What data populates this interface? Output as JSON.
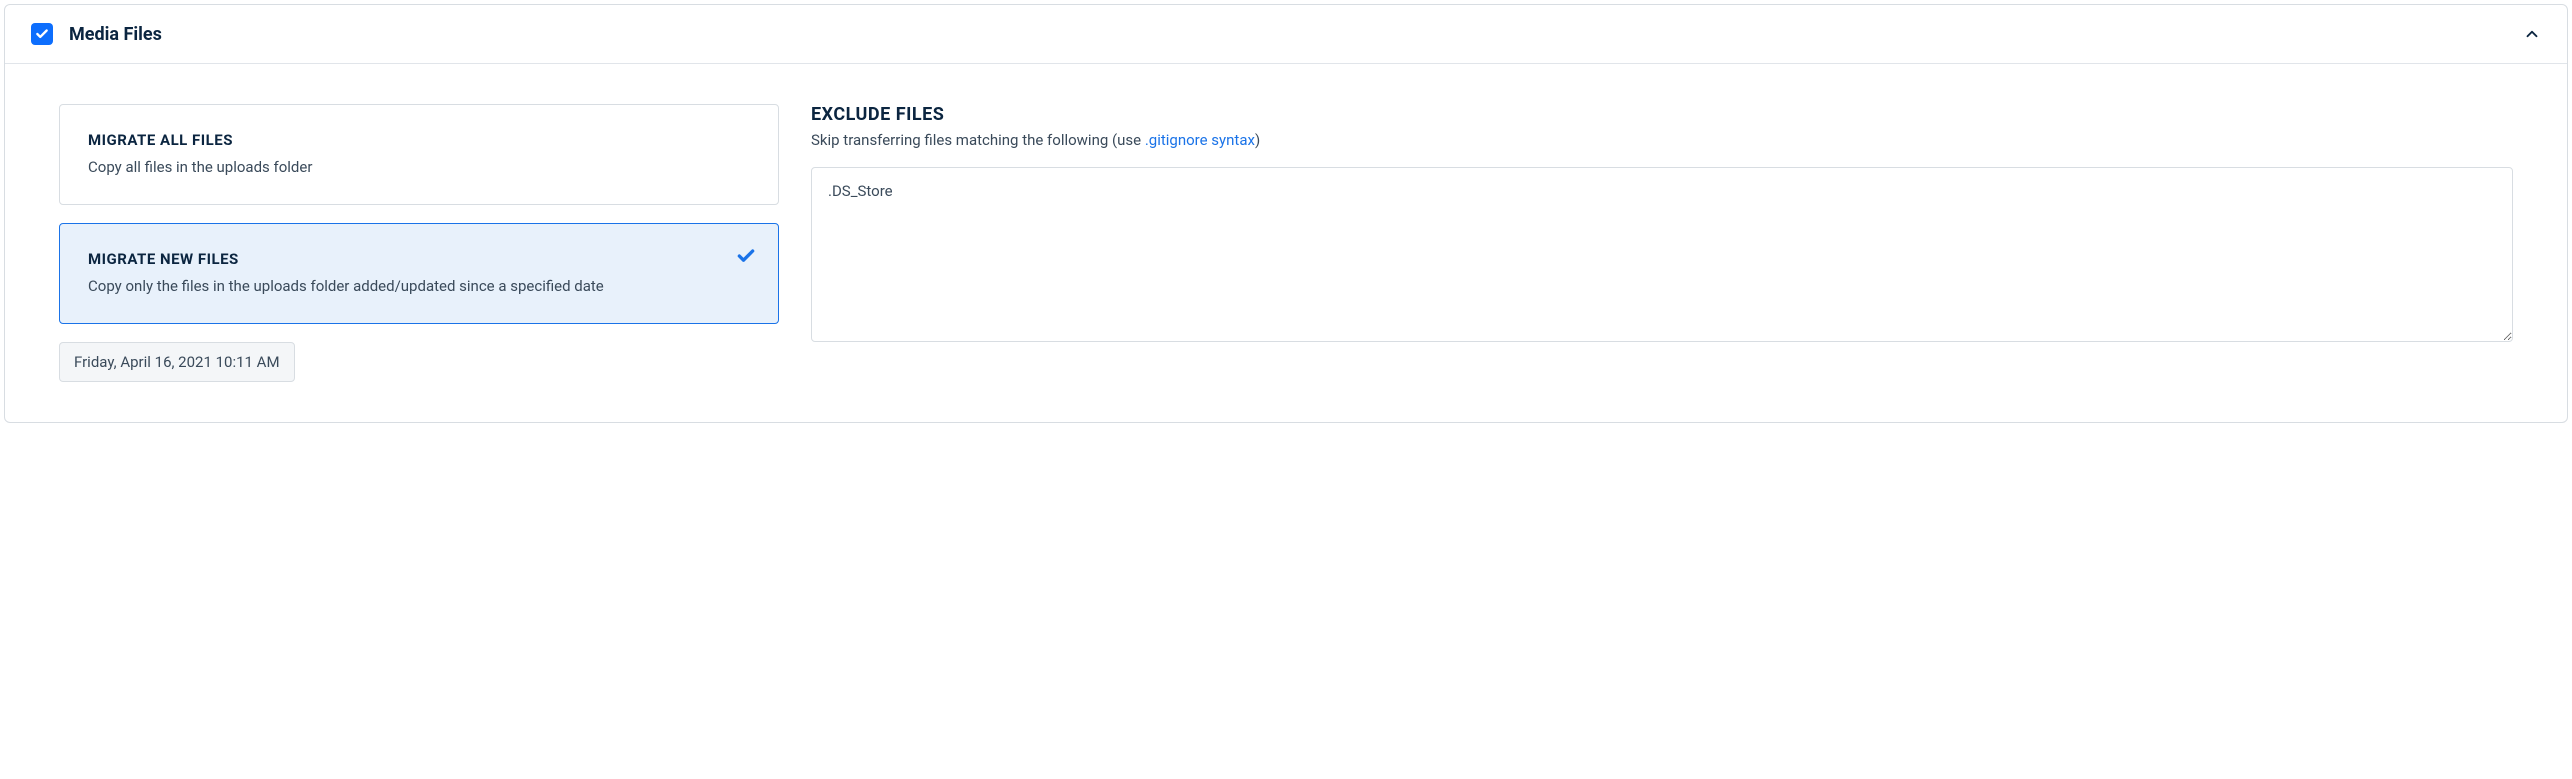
{
  "panel": {
    "title": "Media Files",
    "checked": true
  },
  "options": {
    "migrate_all": {
      "title": "MIGRATE ALL FILES",
      "desc": "Copy all files in the uploads folder"
    },
    "migrate_new": {
      "title": "MIGRATE NEW FILES",
      "desc": "Copy only the files in the uploads folder added/updated since a specified date"
    }
  },
  "date_value": "Friday, April 16, 2021 10:11 AM",
  "exclude": {
    "title": "EXCLUDE FILES",
    "desc_prefix": "Skip transferring files matching the following (use ",
    "link_text": ".gitignore syntax",
    "desc_suffix": ")",
    "value": ".DS_Store"
  }
}
